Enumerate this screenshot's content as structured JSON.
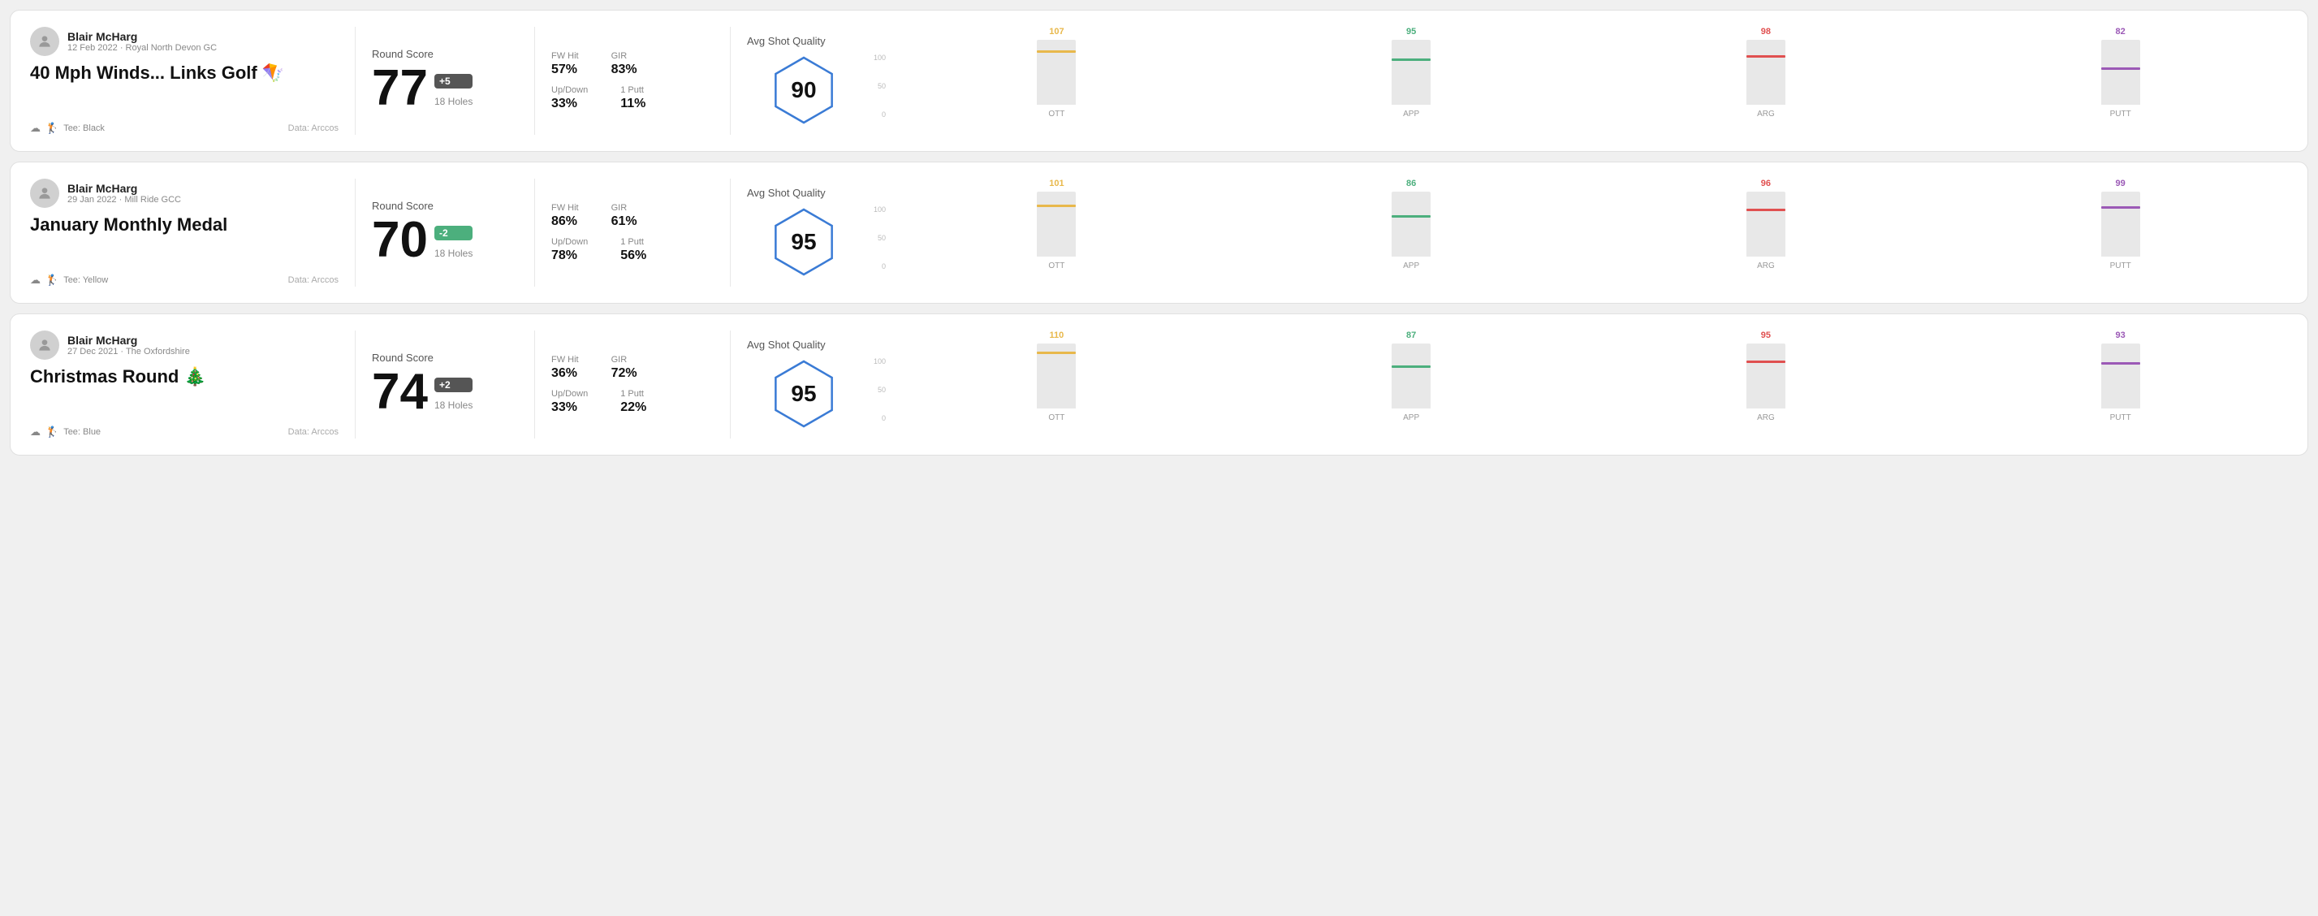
{
  "rounds": [
    {
      "id": "round1",
      "player": {
        "name": "Blair McHarg",
        "date": "12 Feb 2022",
        "course": "Royal North Devon GC"
      },
      "title": "40 Mph Winds... Links Golf 🪁",
      "tee": "Black",
      "data_source": "Data: Arccos",
      "score": {
        "label": "Round Score",
        "value": "77",
        "badge": "+5",
        "holes": "18 Holes"
      },
      "stats": {
        "fw_hit_label": "FW Hit",
        "fw_hit_value": "57%",
        "gir_label": "GIR",
        "gir_value": "83%",
        "updown_label": "Up/Down",
        "updown_value": "33%",
        "oneputt_label": "1 Putt",
        "oneputt_value": "11%"
      },
      "quality": {
        "label": "Avg Shot Quality",
        "score": "90"
      },
      "chart": {
        "bars": [
          {
            "label": "OTT",
            "value": 107,
            "color_class": "ott-bar",
            "value_color": "ott-color",
            "height_pct": 80
          },
          {
            "label": "APP",
            "value": 95,
            "color_class": "app-bar",
            "value_color": "app-color",
            "height_pct": 68
          },
          {
            "label": "ARG",
            "value": 98,
            "color_class": "arg-bar",
            "value_color": "arg-color",
            "height_pct": 72
          },
          {
            "label": "PUTT",
            "value": 82,
            "color_class": "putt-bar",
            "value_color": "putt-color",
            "height_pct": 54
          }
        ]
      }
    },
    {
      "id": "round2",
      "player": {
        "name": "Blair McHarg",
        "date": "29 Jan 2022",
        "course": "Mill Ride GCC"
      },
      "title": "January Monthly Medal",
      "tee": "Yellow",
      "data_source": "Data: Arccos",
      "score": {
        "label": "Round Score",
        "value": "70",
        "badge": "-2",
        "holes": "18 Holes"
      },
      "stats": {
        "fw_hit_label": "FW Hit",
        "fw_hit_value": "86%",
        "gir_label": "GIR",
        "gir_value": "61%",
        "updown_label": "Up/Down",
        "updown_value": "78%",
        "oneputt_label": "1 Putt",
        "oneputt_value": "56%"
      },
      "quality": {
        "label": "Avg Shot Quality",
        "score": "95"
      },
      "chart": {
        "bars": [
          {
            "label": "OTT",
            "value": 101,
            "color_class": "ott-bar",
            "value_color": "ott-color",
            "height_pct": 76
          },
          {
            "label": "APP",
            "value": 86,
            "color_class": "app-bar",
            "value_color": "app-color",
            "height_pct": 60
          },
          {
            "label": "ARG",
            "value": 96,
            "color_class": "arg-bar",
            "value_color": "arg-color",
            "height_pct": 70
          },
          {
            "label": "PUTT",
            "value": 99,
            "color_class": "putt-bar",
            "value_color": "putt-color",
            "height_pct": 74
          }
        ]
      }
    },
    {
      "id": "round3",
      "player": {
        "name": "Blair McHarg",
        "date": "27 Dec 2021",
        "course": "The Oxfordshire"
      },
      "title": "Christmas Round 🎄",
      "tee": "Blue",
      "data_source": "Data: Arccos",
      "score": {
        "label": "Round Score",
        "value": "74",
        "badge": "+2",
        "holes": "18 Holes"
      },
      "stats": {
        "fw_hit_label": "FW Hit",
        "fw_hit_value": "36%",
        "gir_label": "GIR",
        "gir_value": "72%",
        "updown_label": "Up/Down",
        "updown_value": "33%",
        "oneputt_label": "1 Putt",
        "oneputt_value": "22%"
      },
      "quality": {
        "label": "Avg Shot Quality",
        "score": "95"
      },
      "chart": {
        "bars": [
          {
            "label": "OTT",
            "value": 110,
            "color_class": "ott-bar",
            "value_color": "ott-color",
            "height_pct": 84
          },
          {
            "label": "APP",
            "value": 87,
            "color_class": "app-bar",
            "value_color": "app-color",
            "height_pct": 62
          },
          {
            "label": "ARG",
            "value": 95,
            "color_class": "arg-bar",
            "value_color": "arg-color",
            "height_pct": 70
          },
          {
            "label": "PUTT",
            "value": 93,
            "color_class": "putt-bar",
            "value_color": "putt-color",
            "height_pct": 68
          }
        ]
      }
    }
  ]
}
